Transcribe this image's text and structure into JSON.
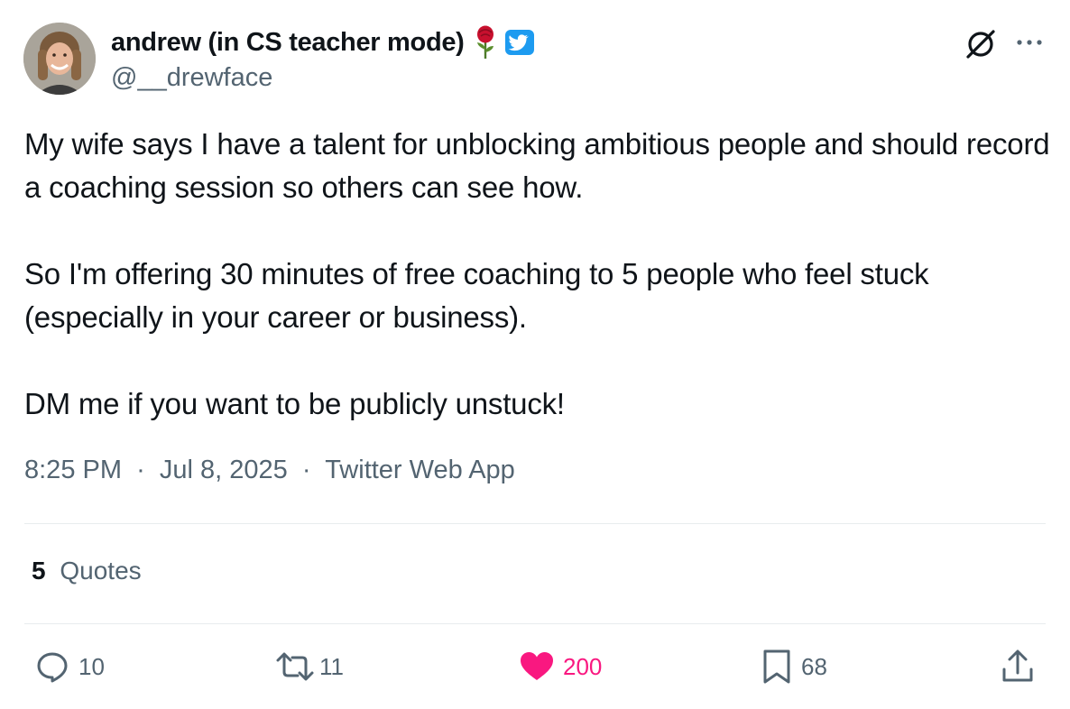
{
  "author": {
    "display_name": "andrew (in CS teacher mode)",
    "handle": "@__drewface",
    "badge_icons": [
      "rose-icon",
      "verified-badge-icon"
    ]
  },
  "header_icons": [
    "grok-icon",
    "more-icon"
  ],
  "tweet": {
    "paragraphs": [
      "My wife says I have a talent for unblocking ambitious people and should record a coaching session so others can see how.",
      "So I'm offering 30 minutes of free coaching to 5 people who feel stuck (especially in your career or business).",
      "DM me if you want to be publicly unstuck!"
    ]
  },
  "meta": {
    "time": "8:25 PM",
    "date": "Jul 8, 2025",
    "source": "Twitter Web App",
    "separator": "·"
  },
  "quotes": {
    "count": "5",
    "label": "Quotes"
  },
  "actions": {
    "replies": "10",
    "retweets": "11",
    "likes": "200",
    "bookmarks": "68"
  },
  "colors": {
    "text": "#0f1419",
    "secondary": "#536471",
    "like": "#f91880",
    "verified": "#1d9bf0",
    "divider": "#e8ecee"
  }
}
